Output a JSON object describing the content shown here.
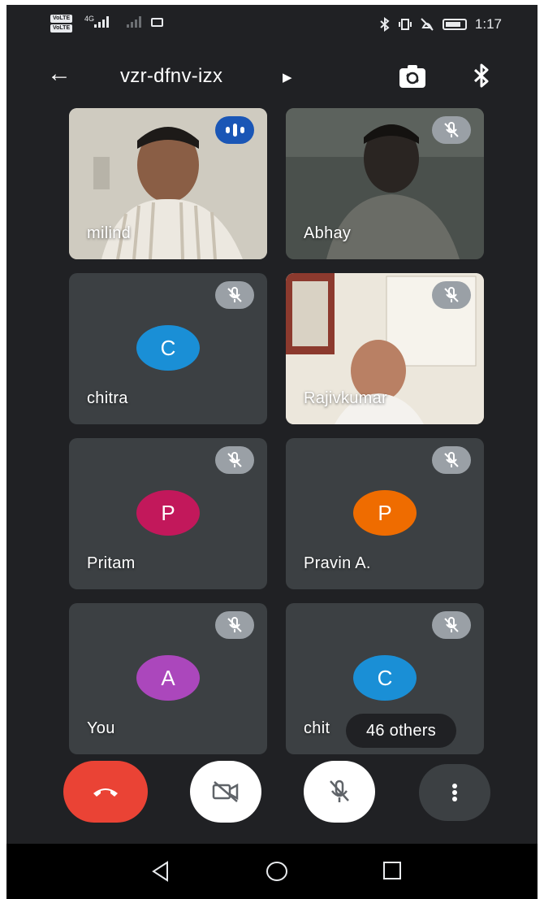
{
  "status_bar": {
    "sim1": "VoLTE",
    "sim2": "VoLTE",
    "network": "4G",
    "time": "1:17"
  },
  "header": {
    "meeting_code": "vzr-dfnv-izx",
    "icons": [
      "back-arrow-icon",
      "expand-caret-icon",
      "switch-camera-icon",
      "bluetooth-icon"
    ]
  },
  "participants": [
    {
      "name": "milind",
      "type": "video",
      "state": "speaking"
    },
    {
      "name": "Abhay",
      "type": "video",
      "state": "muted"
    },
    {
      "name": "chitra",
      "type": "avatar",
      "initial": "C",
      "color": "#1a8fd6",
      "state": "muted"
    },
    {
      "name": "Rajivkumar",
      "type": "video",
      "state": "muted"
    },
    {
      "name": "Pritam",
      "type": "avatar",
      "initial": "P",
      "color": "#c2185b",
      "state": "muted"
    },
    {
      "name": "Pravin A.",
      "type": "avatar",
      "initial": "P",
      "color": "#ef6c00",
      "state": "muted"
    },
    {
      "name": "You",
      "type": "avatar",
      "initial": "A",
      "color": "#ab47bc",
      "state": "muted"
    },
    {
      "name": "chitra",
      "type": "avatar",
      "initial": "C",
      "color": "#1a8fd6",
      "state": "muted",
      "visible_name": "chit"
    }
  ],
  "others_pill": "46 others",
  "controls": {
    "hangup": {
      "icon": "hang-up-icon",
      "color": "#ea4335"
    },
    "camera": {
      "icon": "camera-off-icon"
    },
    "mic": {
      "icon": "mic-off-icon"
    },
    "more": {
      "icon": "more-vert-icon"
    }
  },
  "nav": [
    "nav-back-icon",
    "nav-home-icon",
    "nav-recents-icon"
  ]
}
